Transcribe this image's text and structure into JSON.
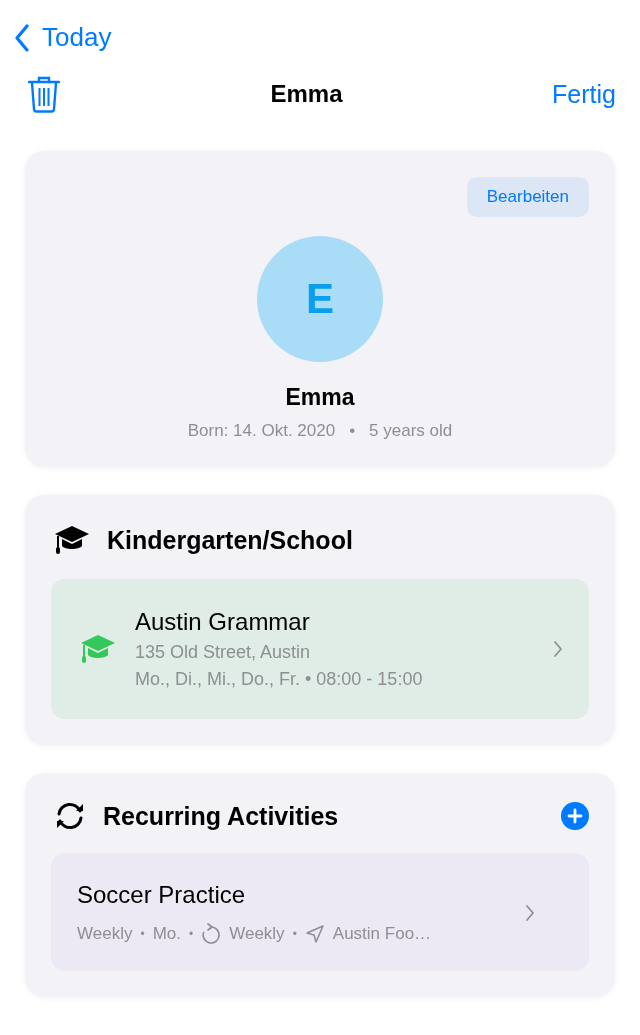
{
  "nav": {
    "back_label": "Today",
    "title": "Emma",
    "done_label": "Fertig"
  },
  "profile": {
    "edit_label": "Bearbeiten",
    "initial": "E",
    "name": "Emma",
    "born": "Born: 14. Okt. 2020",
    "separator": "•",
    "age": "5 years old"
  },
  "school": {
    "title": "Kindergarten/School",
    "items": [
      {
        "name": "Austin Grammar",
        "address": "135 Old Street, Austin",
        "schedule": "Mo., Di., Mi., Do., Fr. • 08:00 - 15:00"
      }
    ]
  },
  "activities": {
    "title": "Recurring Activities",
    "items": [
      {
        "name": "Soccer Practice",
        "meta": [
          {
            "kind": "text",
            "text": "Weekly"
          },
          {
            "kind": "separator",
            "text": "•"
          },
          {
            "kind": "text",
            "text": "Mo."
          },
          {
            "kind": "separator",
            "text": "•"
          },
          {
            "kind": "repeat",
            "text": "Weekly"
          },
          {
            "kind": "separator",
            "text": "•"
          },
          {
            "kind": "location",
            "text": "Austin Foo…"
          }
        ]
      }
    ]
  }
}
